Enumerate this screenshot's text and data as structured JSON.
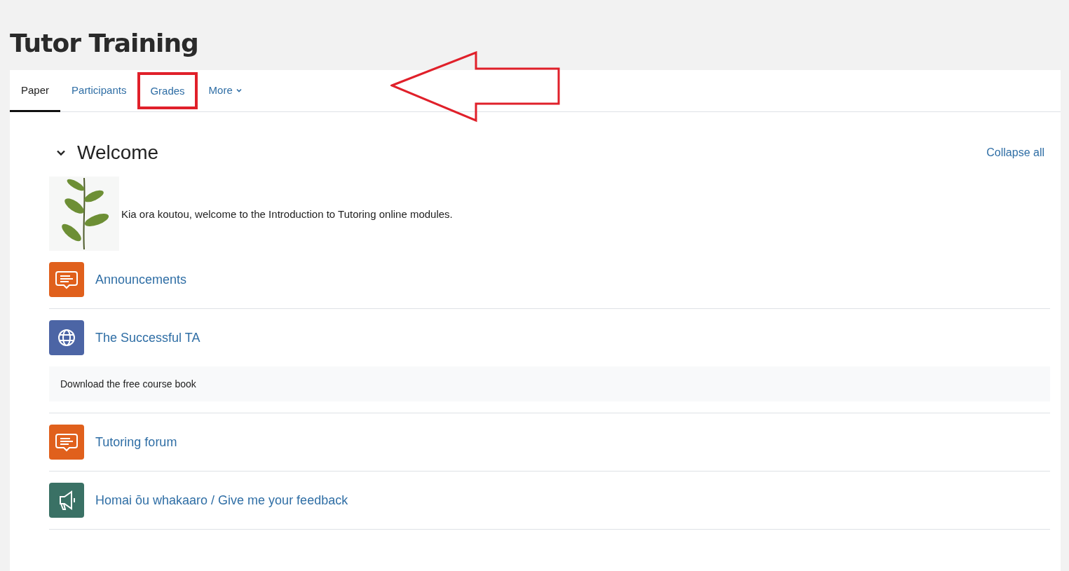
{
  "page_title": "Tutor Training",
  "tabs": [
    {
      "label": "Paper",
      "selected": true,
      "highlighted": false,
      "dropdown": false
    },
    {
      "label": "Participants",
      "selected": false,
      "highlighted": false,
      "dropdown": false
    },
    {
      "label": "Grades",
      "selected": false,
      "highlighted": true,
      "dropdown": false
    },
    {
      "label": "More",
      "selected": false,
      "highlighted": false,
      "dropdown": true
    }
  ],
  "annotation_arrow": true,
  "section": {
    "title": "Welcome",
    "expanded": true,
    "collapse_link": "Collapse all",
    "summary": "Kia ora koutou, welcome to the Introduction to Tutoring online modules.",
    "activities": [
      {
        "kind": "forum",
        "name": "Announcements",
        "color": "#e0601c"
      },
      {
        "kind": "url",
        "name": "The Successful TA",
        "color": "#4c65a5",
        "description": "Download the free course book"
      },
      {
        "kind": "forum",
        "name": "Tutoring forum",
        "color": "#e0601c"
      },
      {
        "kind": "feedback",
        "name": "Homai ōu whakaaro / Give me your feedback",
        "color": "#3a7165"
      }
    ]
  }
}
